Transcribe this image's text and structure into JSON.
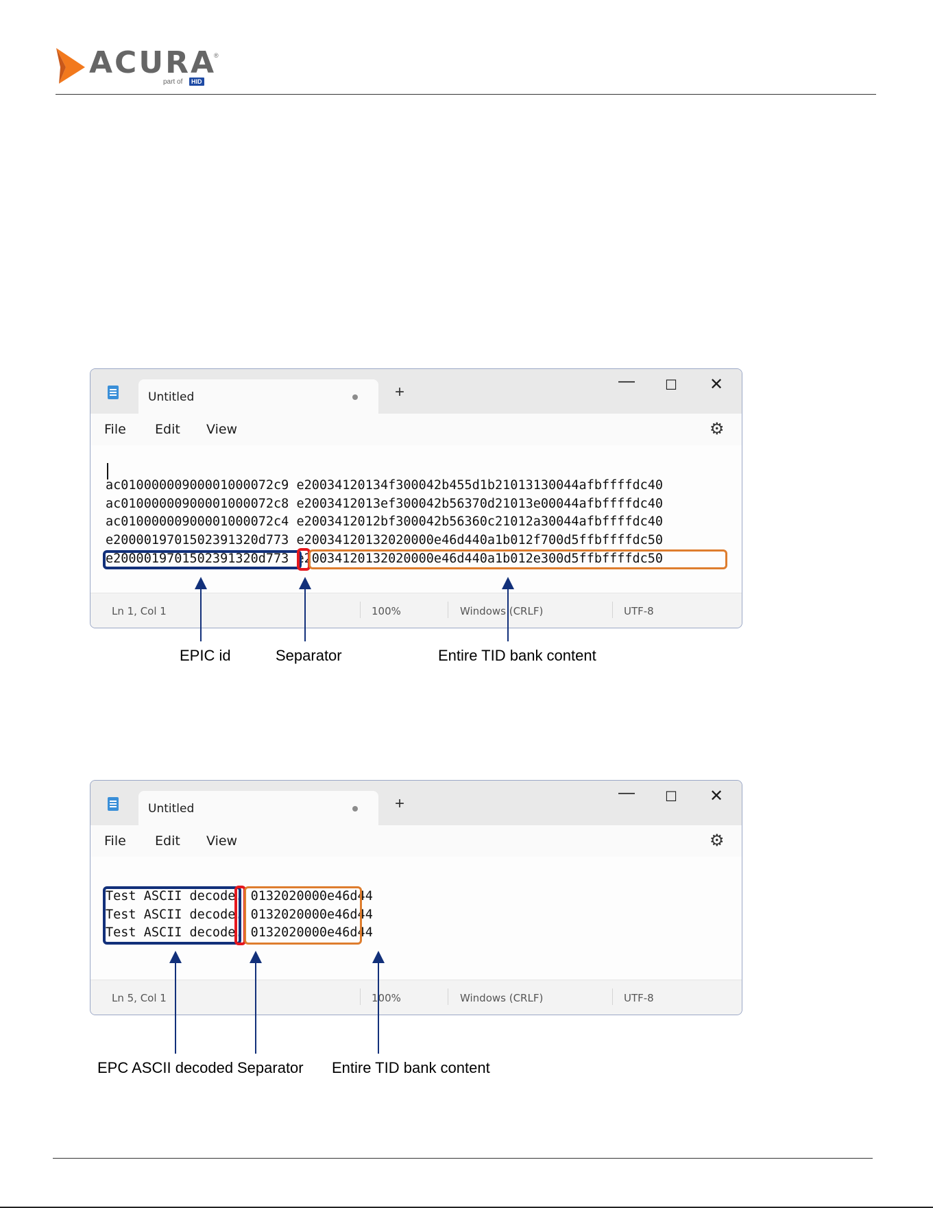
{
  "logo": {
    "word": "ACURA",
    "registered": "®",
    "part_of": "part of",
    "brand": "HID",
    "colors": {
      "chevron": "#f2791d",
      "word": "#666666",
      "hid": "#1f4ba5"
    }
  },
  "windows": [
    {
      "tab_title": "Untitled",
      "new_tab": "+",
      "controls": {
        "minimize": "—",
        "maximize": "☐",
        "close": "✕"
      },
      "menu": [
        "File",
        "Edit",
        "View"
      ],
      "gear_icon": "⚙",
      "lines": [
        "ac01000000900001000072c9 e20034120134f300042b455d1b21013130044afbffffdc40",
        "ac01000000900001000072c8 e2003412013ef300042b56370d21013e00044afbffffdc40",
        "ac01000000900001000072c4 e2003412012bf300042b56360c21012a30044afbffffdc40",
        "e2000019701502391320d773 e20034120132020000e46d440a1b012f700d5ffbffffdc50",
        "e2000019701502391320d773 e20034120132020000e46d440a1b012e300d5ffbffffdc50"
      ],
      "status": {
        "position": "Ln 1, Col 1",
        "zoom": "100%",
        "line_ending": "Windows (CRLF)",
        "encoding": "UTF-8"
      }
    },
    {
      "tab_title": "Untitled",
      "new_tab": "+",
      "controls": {
        "minimize": "—",
        "maximize": "☐",
        "close": "✕"
      },
      "menu": [
        "File",
        "Edit",
        "View"
      ],
      "gear_icon": "⚙",
      "lines": [
        "Test ASCII decode. 0132020000e46d44",
        "Test ASCII decode. 0132020000e46d44",
        "Test ASCII decode. 0132020000e46d44"
      ],
      "status": {
        "position": "Ln 5, Col 1",
        "zoom": "100%",
        "line_ending": "Windows (CRLF)",
        "encoding": "UTF-8"
      }
    }
  ],
  "callouts_1": {
    "epc": "EPIC id",
    "separator": "Separator",
    "tid": "Entire TID bank content"
  },
  "callouts_2": {
    "epc": "EPC ASCII decoded",
    "separator": "Separator",
    "tid": "Entire TID bank content"
  },
  "colors": {
    "blue_box": "#12307a",
    "red_box": "#e5171d",
    "orange_box": "#de7d2e",
    "arrow": "#12307a"
  }
}
